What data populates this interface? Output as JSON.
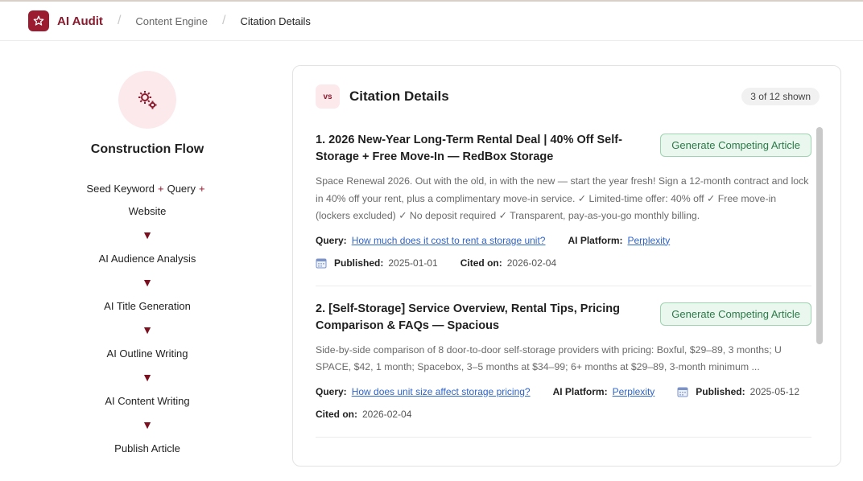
{
  "header": {
    "brand": "AI Audit",
    "breadcrumb": [
      "Content Engine",
      "Citation Details"
    ]
  },
  "flow": {
    "title": "Construction Flow",
    "inputs": [
      "Seed Keyword",
      "Query",
      "Website"
    ],
    "plus": "+",
    "arrow": "▼",
    "steps": [
      "AI Audience Analysis",
      "AI Title Generation",
      "AI Outline Writing",
      "AI Content Writing",
      "Publish Article"
    ]
  },
  "panel": {
    "badge": "vs",
    "title": "Citation Details",
    "count": "3 of 12 shown",
    "button_label": "Generate Competing Article",
    "labels": {
      "query": "Query:",
      "platform": "AI Platform:",
      "published": "Published:",
      "cited": "Cited on:"
    },
    "items": [
      {
        "title": "1. 2026 New-Year Long-Term Rental Deal | 40% Off Self-Storage + Free Move-In — RedBox Storage",
        "description": "Space Renewal 2026. Out with the old, in with the new — start the year fresh! Sign a 12-month contract and lock in 40% off your rent, plus a complimentary move-in service. ✓ Limited-time offer: 40% off ✓ Free move-in (lockers excluded) ✓ No deposit required ✓ Transparent, pay-as-you-go monthly billing.",
        "query": "How much does it cost to rent a storage unit?",
        "platform": "Perplexity",
        "published": "2025-01-01",
        "cited": "2026-02-04"
      },
      {
        "title": "2. [Self-Storage] Service Overview, Rental Tips, Pricing Comparison & FAQs — Spacious",
        "description": "Side-by-side comparison of 8 door-to-door self-storage providers with pricing: Boxful, $29–89, 3 months; U SPACE, $42, 1 month; Spacebox, 3–5 months at $34–99; 6+ months at $29–89, 3-month minimum ...",
        "query": "How does unit size affect storage pricing?",
        "platform": "Perplexity",
        "published": "2025-05-12",
        "cited": "2026-02-04"
      }
    ]
  },
  "colors": {
    "brand": "#9b1b30",
    "accent_bg": "#fce9ec",
    "button_bg": "#eaf7ee",
    "button_text": "#2b7a48",
    "link": "#2e64c9"
  }
}
